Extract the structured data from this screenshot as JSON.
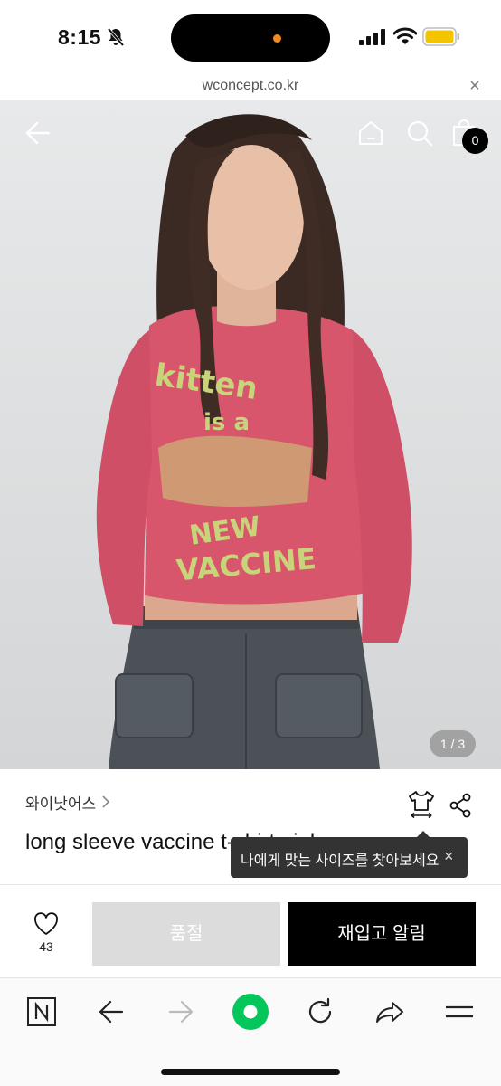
{
  "status_bar": {
    "time": "8:15",
    "icons": [
      "bell-slash-icon",
      "signal-icon",
      "wifi-icon",
      "battery-icon"
    ],
    "battery_color": "#f5c400",
    "island_dot_color": "#f28a1e"
  },
  "browser": {
    "url": "wconcept.co.kr",
    "close_label": "×"
  },
  "header": {
    "icons": [
      "back-arrow-icon",
      "home-icon",
      "search-icon",
      "shopping-bag-icon"
    ],
    "cart_count": "0"
  },
  "gallery": {
    "counter": "1 / 3",
    "current": 1,
    "total": 3
  },
  "product": {
    "brand": "와이낫어스",
    "title": "long sleeve vaccine t-shirt pink",
    "size_tooltip": "나에게 맞는 사이즈를 찾아보세요",
    "tooltip_close": "×",
    "icons": [
      "size-guide-icon",
      "share-icon"
    ]
  },
  "actions": {
    "like_count": "43",
    "soldout_label": "품절",
    "restock_label": "재입고 알림",
    "restock_bg": "#000000",
    "soldout_bg": "#dcdcdc"
  },
  "toolbar": {
    "icons": [
      "naver-n-icon",
      "back-icon",
      "forward-icon",
      "green-dot-icon",
      "refresh-icon",
      "share-arrow-icon",
      "menu-icon"
    ],
    "accent": "#03c75a"
  }
}
